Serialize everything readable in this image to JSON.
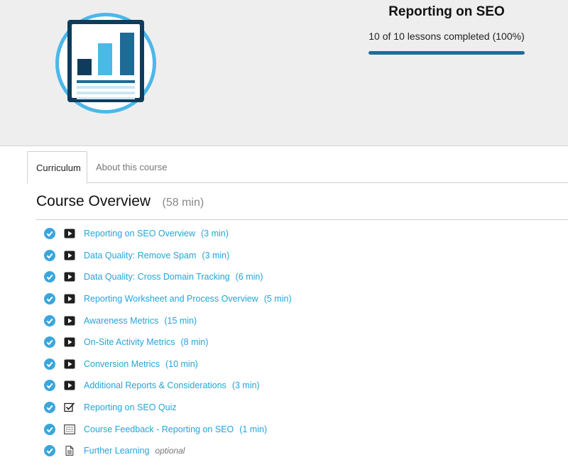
{
  "course": {
    "title": "Reporting on SEO",
    "progress_text": "10 of 10 lessons completed (100%)",
    "progress_fraction": 1.0
  },
  "tabs": [
    {
      "label": "Curriculum",
      "active": true
    },
    {
      "label": "About this course",
      "active": false
    }
  ],
  "section": {
    "title": "Course Overview",
    "duration": "(58 min)"
  },
  "lessons": [
    {
      "icon": "play-icon",
      "title": "Reporting on SEO Overview",
      "duration": "(3 min)",
      "optional": ""
    },
    {
      "icon": "play-icon",
      "title": "Data Quality: Remove Spam",
      "duration": "(3 min)",
      "optional": ""
    },
    {
      "icon": "play-icon",
      "title": "Data Quality: Cross Domain Tracking",
      "duration": "(6 min)",
      "optional": ""
    },
    {
      "icon": "play-icon",
      "title": "Reporting Worksheet and Process Overview",
      "duration": "(5 min)",
      "optional": ""
    },
    {
      "icon": "play-icon",
      "title": "Awareness Metrics",
      "duration": "(15 min)",
      "optional": ""
    },
    {
      "icon": "play-icon",
      "title": "On-Site Activity Metrics",
      "duration": "(8 min)",
      "optional": ""
    },
    {
      "icon": "play-icon",
      "title": "Conversion Metrics",
      "duration": "(10 min)",
      "optional": ""
    },
    {
      "icon": "play-icon",
      "title": "Additional Reports & Considerations",
      "duration": "(3 min)",
      "optional": ""
    },
    {
      "icon": "checkbox-icon",
      "title": "Reporting on SEO Quiz",
      "duration": "",
      "optional": ""
    },
    {
      "icon": "form-icon",
      "title": "Course Feedback - Reporting on SEO",
      "duration": "(1 min)",
      "optional": ""
    },
    {
      "icon": "document-icon",
      "title": "Further Learning",
      "duration": "",
      "optional": "optional"
    }
  ],
  "colors": {
    "accent": "#27a3d8",
    "progress": "#1f6b96",
    "check": "#3aa6dc"
  }
}
